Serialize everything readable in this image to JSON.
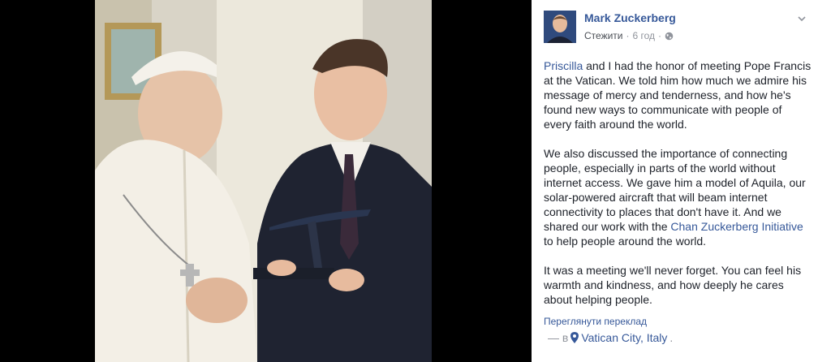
{
  "post": {
    "author": "Mark Zuckerberg",
    "follow_label": "Стежити",
    "separator": "·",
    "time": "6 год",
    "paragraph1": {
      "mention": "Priscilla",
      "text": " and I had the honor of meeting Pope Francis at the Vatican. We told him how much we admire his message of mercy and tenderness, and how he's found new ways to communicate with people of every faith around the world."
    },
    "paragraph2": {
      "text_before": "We also discussed the importance of connecting people, especially in parts of the world without internet access. We gave him a model of Aquila, our solar-powered aircraft that will beam internet connectivity to places that don't have it. And we shared our work with the ",
      "link": "Chan Zuckerberg Initiative",
      "text_after": " to help people around the world."
    },
    "paragraph3": {
      "text": "It was a meeting we'll never forget. You can feel his warmth and kindness, and how deeply he cares about helping people."
    },
    "translate_label": "Переглянути переклад",
    "location": {
      "prefix": "— в",
      "place": "Vatican City, Italy",
      "suffix": "."
    }
  },
  "colors": {
    "link": "#365899",
    "text": "#1d2129",
    "meta": "#90949c",
    "backdrop": "#000000"
  },
  "icons": [
    "globe-icon",
    "chevron-down-icon",
    "location-pin-icon"
  ]
}
